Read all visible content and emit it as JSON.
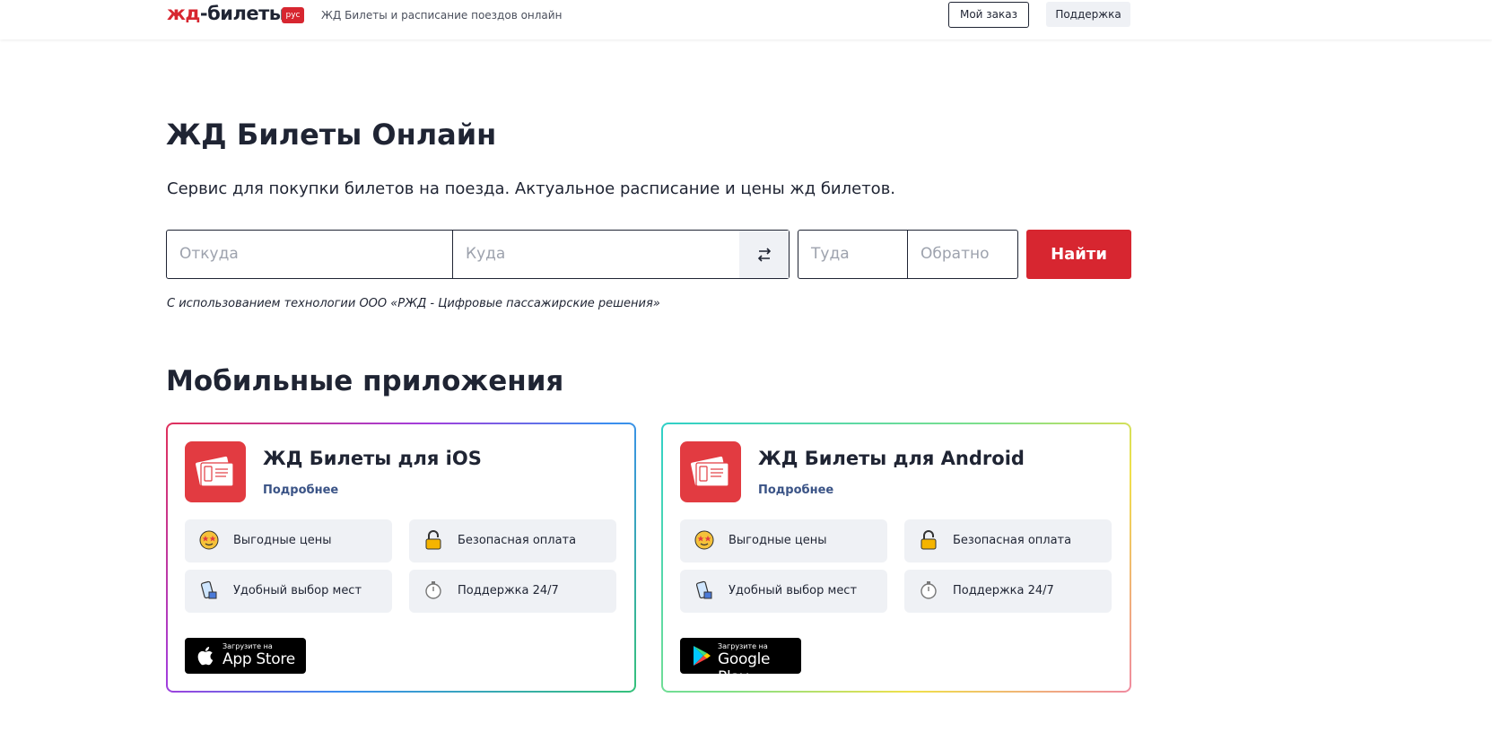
{
  "header": {
    "logo_zhd": "жд",
    "logo_rest": "-билеты",
    "logo_badge": "рус",
    "tagline": "ЖД Билеты и расписание поездов онлайн",
    "my_order": "Мой заказ",
    "support": "Поддержка"
  },
  "hero": {
    "title": "ЖД Билеты Онлайн",
    "subtitle": "Сервис для покупки билетов на поезда. Актуальное расписание и цены жд билетов."
  },
  "search": {
    "from_placeholder": "Откуда",
    "to_placeholder": "Куда",
    "date_there_placeholder": "Туда",
    "date_back_placeholder": "Обратно",
    "find_label": "Найти",
    "accent_color": "#d72630"
  },
  "tech_note": "С использованием технологии ООО «РЖД - Цифровые пассажирские решения»",
  "apps": {
    "title": "Мобильные приложения",
    "ios": {
      "title": "ЖД Билеты для iOS",
      "more": "Подробнее",
      "features": [
        "Выгодные цены",
        "Безопасная оплата",
        "Удобный выбор мест",
        "Поддержка 24/7"
      ],
      "store_small": "Загрузите на",
      "store_big": "App Store"
    },
    "android": {
      "title": "ЖД Билеты для Android",
      "more": "Подробнее",
      "features": [
        "Выгодные цены",
        "Безопасная оплата",
        "Удобный выбор мест",
        "Поддержка 24/7"
      ],
      "store_small": "Загрузите на",
      "store_big": "Google Play"
    }
  }
}
